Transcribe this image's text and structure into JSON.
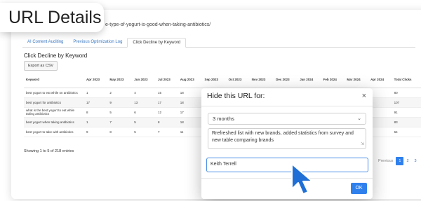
{
  "overlay_title": "URL Details",
  "url_fragment": "e-type-of-yogurt-is-good-when-taking-antibiotics/",
  "tabs": [
    {
      "label": "AI Content Auditing"
    },
    {
      "label": "Previous Optimization Log"
    },
    {
      "label": "Click Decline by Keyword",
      "active": true
    }
  ],
  "section_title": "Click Decline by Keyword",
  "export_label": "Export as CSV",
  "table": {
    "headers": [
      "Keyword",
      "Apr 2023",
      "May 2023",
      "Jun 2023",
      "Jul 2023",
      "Aug 2023",
      "Sep 2023",
      "Oct 2023",
      "Nov 2023",
      "Dec 2023",
      "Jan 2024",
      "Feb 2024",
      "Mar 2024",
      "Apr 2024",
      "Total Clicks"
    ],
    "rows": [
      [
        "best yogurt to eat while on antibiotics",
        "1",
        "2",
        "4",
        "15",
        "18",
        "",
        "",
        "",
        "",
        "",
        "",
        "",
        "0",
        "80"
      ],
      [
        "best yogurt for antibiotics",
        "17",
        "9",
        "13",
        "17",
        "18",
        "",
        "",
        "",
        "",
        "",
        "",
        "",
        "0",
        "107"
      ],
      [
        "what is the best yogurt to eat while taking antibiotics",
        "8",
        "5",
        "6",
        "12",
        "17",
        "",
        "",
        "",
        "",
        "",
        "",
        "",
        "0",
        "91"
      ],
      [
        "best yogurt when taking antibiotics",
        "1",
        "7",
        "5",
        "8",
        "18",
        "",
        "",
        "",
        "",
        "",
        "",
        "",
        "0",
        "83"
      ],
      [
        "best yogurt to take with antibiotics",
        "9",
        "8",
        "5",
        "7",
        "11",
        "",
        "",
        "",
        "",
        "",
        "",
        "",
        "0",
        "64"
      ]
    ]
  },
  "showing_text": "Showing 1 to 5 of 218 entries",
  "pager": {
    "prev": "Previous",
    "pages": [
      "1",
      "2",
      "3"
    ]
  },
  "modal": {
    "title": "Hide this URL for:",
    "close": "×",
    "duration": "3 months",
    "reason": "Rrefreshed list with new brands, added statistics from survey and new table comparing brands",
    "name": "Keith Terrell",
    "ok": "OK"
  },
  "colors": {
    "accent": "#2f80ed",
    "cursor": "#1f6fd6"
  }
}
